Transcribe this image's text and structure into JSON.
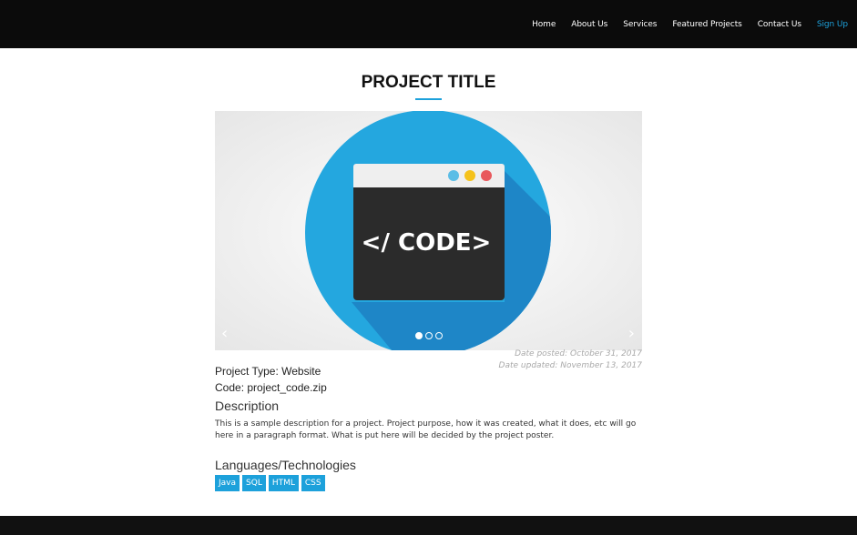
{
  "nav": {
    "items": [
      "Home",
      "About Us",
      "Services",
      "Featured Projects",
      "Contact Us"
    ],
    "signup": "Sign Up"
  },
  "project": {
    "title": "PROJECT TITLE",
    "image_text": "</ CODE>",
    "date_posted": "Date posted: October 31, 2017",
    "date_updated": "Date updated: November 13, 2017",
    "type": "Project Type: Website",
    "code": "Code: project_code.zip",
    "description_heading": "Description",
    "description": "This is a sample description for a project. Project purpose, how it was created, what it does, etc will go here in a paragraph format. What is put here will be decided by the project poster.",
    "languages_heading": "Languages/Technologies",
    "tags": [
      "Java",
      "SQL",
      "HTML",
      "CSS"
    ]
  },
  "carousel": {
    "prev": "‹",
    "next": "›",
    "slide_count": 3,
    "active_index": 0
  },
  "colors": {
    "accent": "#1da1db",
    "navbar": "#0b0b0b",
    "circle": "#24a7df",
    "window": "#2b2b2b"
  },
  "icons": {
    "window_buttons": [
      "blue",
      "yellow",
      "red"
    ]
  }
}
